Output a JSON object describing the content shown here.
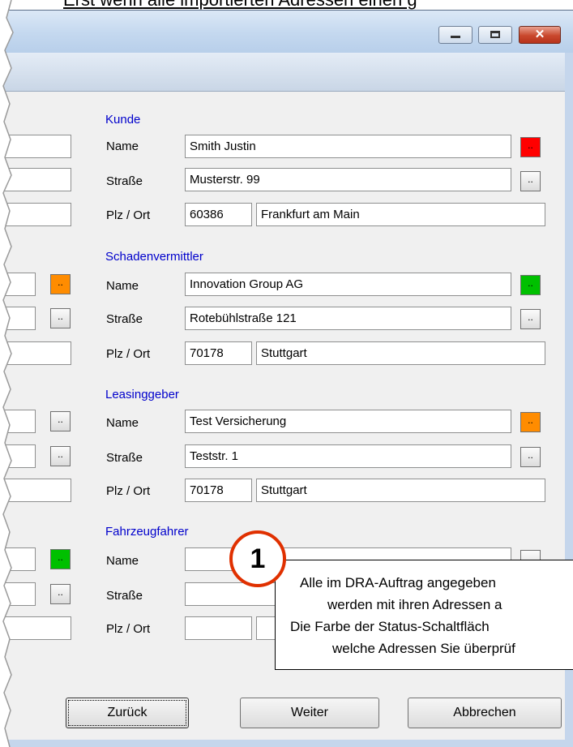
{
  "caption": {
    "text": "Erst wenn alle importierten Adressen einen g"
  },
  "window": {
    "controls": {
      "minimize": "minimize",
      "maximize": "maximize",
      "close": "✕"
    }
  },
  "sections": [
    {
      "title": "Kunde",
      "name_label": "Name",
      "street_label": "Straße",
      "city_label": "Plz / Ort",
      "name": "Smith Justin",
      "street": "Musterstr. 99",
      "zip": "60386",
      "city": "Frankfurt am Main",
      "status_color": "#ff0000"
    },
    {
      "title": "Schadenvermittler",
      "name_label": "Name",
      "street_label": "Straße",
      "city_label": "Plz / Ort",
      "name": "Innovation Group AG",
      "street": "Rotebühlstraße 121",
      "zip": "70178",
      "city": "Stuttgart",
      "status_color": "#00c000"
    },
    {
      "title": "Leasinggeber",
      "name_label": "Name",
      "street_label": "Straße",
      "city_label": "Plz / Ort",
      "name": "Test Versicherung",
      "street": "Teststr. 1",
      "zip": "70178",
      "city": "Stuttgart",
      "status_color": "#ff8c00"
    },
    {
      "title": "Fahrzeugfahrer",
      "name_label": "Name",
      "street_label": "Straße",
      "city_label": "Plz / Ort",
      "name": "",
      "street": "",
      "zip": "",
      "city": ""
    }
  ],
  "dots": "..",
  "buttons": {
    "back": "Zurück",
    "next": "Weiter",
    "cancel": "Abbrechen"
  },
  "callout": {
    "badge": "1",
    "lines": [
      "Alle im DRA-Auftrag angegeben",
      "werden mit ihren Adressen a",
      "Die Farbe der Status-Schaltfläch",
      "welche Adressen Sie überprüf"
    ]
  },
  "colors": {
    "red": "#ff0000",
    "green": "#00c000",
    "orange": "#ff8c00",
    "group_title": "#0000cc",
    "badge_ring": "#e03000"
  }
}
